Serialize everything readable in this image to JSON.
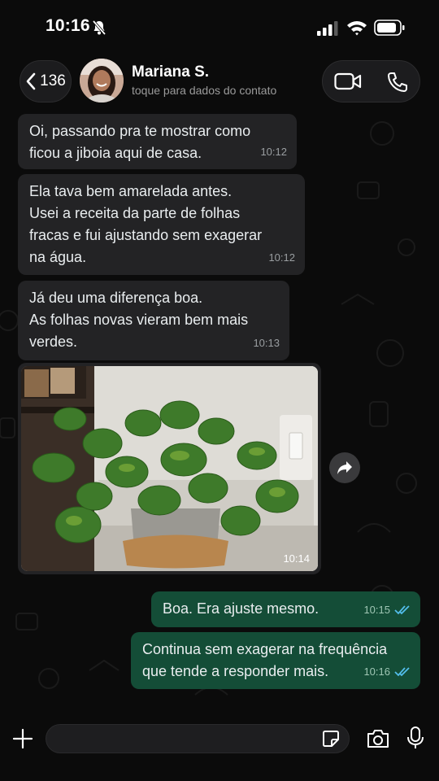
{
  "status_bar": {
    "time": "10:16"
  },
  "header": {
    "back_count": "136",
    "contact_name": "Mariana S.",
    "contact_subtitle": "toque para dados do contato"
  },
  "messages": [
    {
      "direction": "in",
      "text": "Oi, passando pra te mostrar como\nficou a jiboia aqui de casa.",
      "time": "10:12"
    },
    {
      "direction": "in",
      "text": "Ela tava bem amarelada antes.\nUsei a receita da parte de folhas\nfracas e fui ajustando sem exagerar\nna água.",
      "time": "10:12"
    },
    {
      "direction": "in",
      "text": "Já deu uma diferença boa.\nAs folhas novas vieram bem mais\nverdes.",
      "time": "10:13"
    },
    {
      "direction": "in",
      "type": "photo",
      "time": "10:14"
    },
    {
      "direction": "out",
      "text": "Boa. Era ajuste mesmo.",
      "time": "10:15"
    },
    {
      "direction": "out",
      "text": "Continua sem exagerar na frequência\nque tende a responder mais.",
      "time": "10:16"
    }
  ],
  "colors": {
    "incoming_bubble": "#232325",
    "outgoing_bubble": "#144d37",
    "read_ticks": "#53bdeb"
  }
}
